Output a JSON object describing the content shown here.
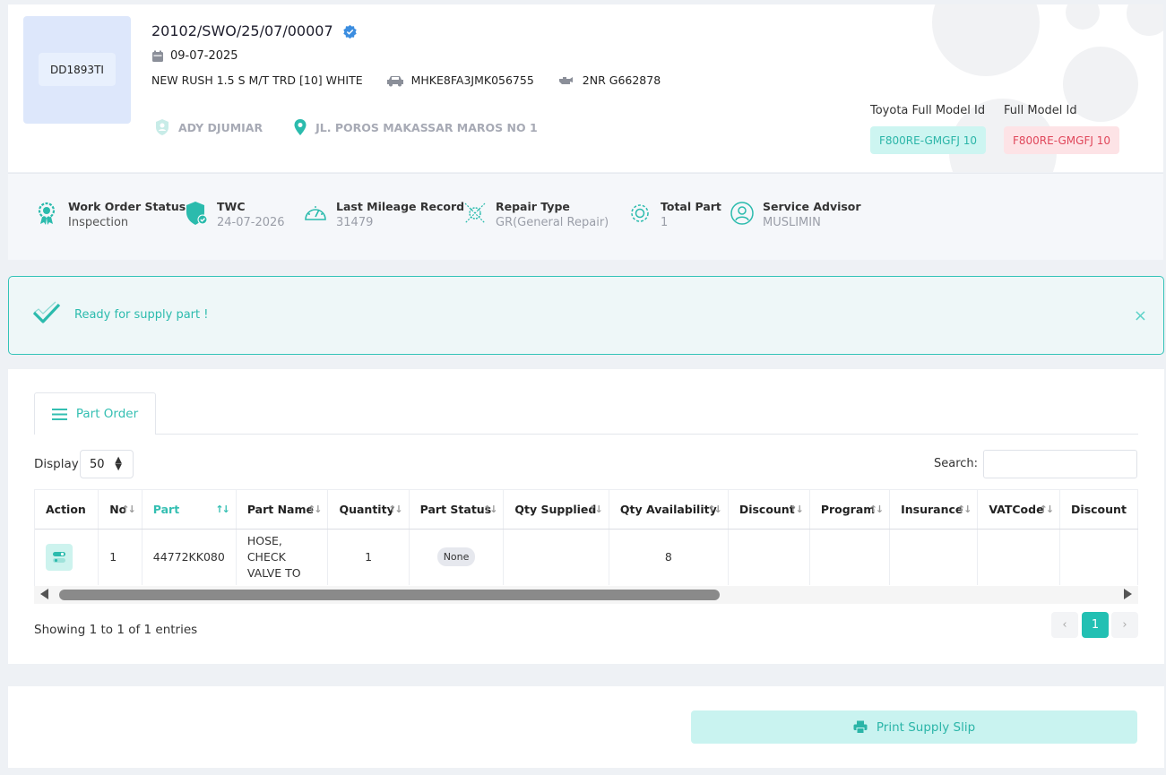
{
  "header": {
    "plate": "DD1893TI",
    "wo_number": "20102/SWO/25/07/00007",
    "date": "09-07-2025",
    "vehicle": "NEW RUSH 1.5 S M/T TRD [10] WHITE",
    "vin": "MHKE8FA3JMK056755",
    "engine": "2NR G662878",
    "customer": "ADY DJUMIAR",
    "address": "JL. POROS MAKASSAR MAROS NO 1",
    "toyota_model_label": "Toyota Full Model Id",
    "toyota_model_value": "F800RE-GMGFJ 10",
    "full_model_label": "Full Model Id",
    "full_model_value": "F800RE-GMGFJ 10"
  },
  "info": {
    "status_title": "Work Order Status",
    "status_value": "Inspection",
    "twc_title": "TWC",
    "twc_value": "24-07-2026",
    "mileage_title": "Last Mileage Record",
    "mileage_value": "31479",
    "repair_title": "Repair Type",
    "repair_value": "GR(General Repair)",
    "total_title": "Total Part",
    "total_value": "1",
    "advisor_title": "Service Advisor",
    "advisor_value": "MUSLIMIN"
  },
  "alert": {
    "message": "Ready for supply part !",
    "close": "×"
  },
  "parts": {
    "tab_label": "Part Order",
    "display_label": "Display",
    "display_value": "50",
    "search_label": "Search:",
    "columns": [
      "Action",
      "No",
      "Part",
      "Part Name",
      "Quantity",
      "Part Status",
      "Qty Supplied",
      "Qty Availability",
      "Discount",
      "Program",
      "Insurance",
      "VATCode",
      "Discount"
    ],
    "row": {
      "no": "1",
      "part": "44772KK080",
      "part_name": "HOSE, CHECK VALVE TO",
      "quantity": "1",
      "status": "None",
      "qty_supplied": "",
      "qty_availability": "8"
    },
    "showing": "Showing 1 to 1 of 1 entries",
    "pagination": {
      "prev": "‹",
      "current": "1",
      "next": "›"
    }
  },
  "footer": {
    "print_label": "Print Supply Slip"
  },
  "colors": {
    "accent": "#34bfb2",
    "blue_badge": "#3b8de0",
    "danger": "#e0475b"
  }
}
